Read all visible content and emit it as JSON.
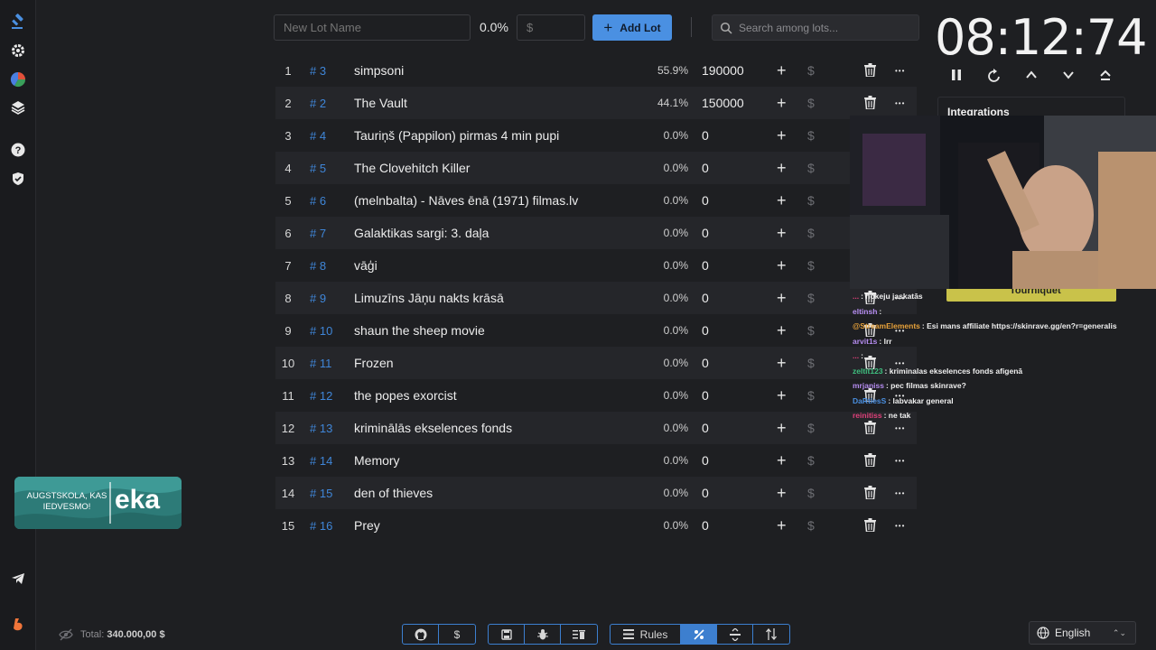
{
  "nav": {
    "items": [
      {
        "icon": "gavel-icon"
      },
      {
        "icon": "gear-icon"
      },
      {
        "icon": "pie-chart-icon"
      },
      {
        "icon": "layers-icon"
      },
      {
        "icon": "help-icon"
      },
      {
        "icon": "shield-icon"
      },
      {
        "icon": "telegram-icon"
      },
      {
        "icon": "boosty-icon"
      }
    ]
  },
  "toolbar": {
    "lot_name_placeholder": "New Lot Name",
    "percent": "0.0%",
    "amount_placeholder": "$",
    "add_lot_label": "Add Lot",
    "search_placeholder": "Search among lots..."
  },
  "lots": [
    {
      "index": "1",
      "id": "# 3",
      "name": "simpsoni",
      "percent": "55.9%",
      "amount": "190000"
    },
    {
      "index": "2",
      "id": "# 2",
      "name": "The Vault",
      "percent": "44.1%",
      "amount": "150000"
    },
    {
      "index": "3",
      "id": "# 4",
      "name": "Tauriņš (Pappilon) pirmas 4 min pupi",
      "percent": "0.0%",
      "amount": "0"
    },
    {
      "index": "4",
      "id": "# 5",
      "name": "The Clovehitch Killer",
      "percent": "0.0%",
      "amount": "0"
    },
    {
      "index": "5",
      "id": "# 6",
      "name": "(melnbalta) - Nāves ēnā (1971) filmas.lv",
      "percent": "0.0%",
      "amount": "0"
    },
    {
      "index": "6",
      "id": "# 7",
      "name": "Galaktikas sargi: 3. daļa",
      "percent": "0.0%",
      "amount": "0"
    },
    {
      "index": "7",
      "id": "# 8",
      "name": "vāģi",
      "percent": "0.0%",
      "amount": "0"
    },
    {
      "index": "8",
      "id": "# 9",
      "name": "Limuzīns Jāņu nakts krāsā",
      "percent": "0.0%",
      "amount": "0"
    },
    {
      "index": "9",
      "id": "# 10",
      "name": "shaun the sheep movie",
      "percent": "0.0%",
      "amount": "0"
    },
    {
      "index": "10",
      "id": "# 11",
      "name": "Frozen",
      "percent": "0.0%",
      "amount": "0"
    },
    {
      "index": "11",
      "id": "# 12",
      "name": "the popes exorcist",
      "percent": "0.0%",
      "amount": "0"
    },
    {
      "index": "12",
      "id": "# 13",
      "name": "kriminālās ekselences fonds",
      "percent": "0.0%",
      "amount": "0"
    },
    {
      "index": "13",
      "id": "# 14",
      "name": "Memory",
      "percent": "0.0%",
      "amount": "0"
    },
    {
      "index": "14",
      "id": "# 15",
      "name": "den of thieves",
      "percent": "0.0%",
      "amount": "0"
    },
    {
      "index": "15",
      "id": "# 16",
      "name": "Prey",
      "percent": "0.0%",
      "amount": "0"
    }
  ],
  "timer": {
    "display": "08:12:74",
    "controls": [
      "pause-icon",
      "reset-icon",
      "chevron-up-icon",
      "chevron-down-icon",
      "eject-icon"
    ]
  },
  "integrations": {
    "title": "Integrations"
  },
  "overlay": {
    "tourniquet_label": "Tourniquet",
    "chat": [
      {
        "user": "...",
        "text": ": hokeju jaskatās",
        "color": "#e0407a"
      },
      {
        "user": "eltinsh",
        "text": ":",
        "color": "#b58cf0"
      },
      {
        "user": "@StreamElements",
        "text": ": Esi mans affiliate https://skinrave.gg/en?r=generalis",
        "color": "#e8a23a"
      },
      {
        "user": "arvit1s",
        "text": ": lrr",
        "color": "#b58cf0"
      },
      {
        "user": "...",
        "text": ":",
        "color": "#e0407a"
      },
      {
        "user": "zeltit123",
        "text": ": kriminalas ekselences fonds afigenā",
        "color": "#3fbf7f"
      },
      {
        "user": "mrjaniss",
        "text": ": pec filmas skinrave?",
        "color": "#b58cf0"
      },
      {
        "user": "DaRtiesS",
        "text": ": labvakar general",
        "color": "#4a8fe0"
      },
      {
        "user": "reinitiss",
        "text": ": ne tak",
        "color": "#e0407a"
      }
    ],
    "eka_badge": {
      "line1": "AUGSTSKOLA, KAS",
      "line2": "IEDVESMO!",
      "brand": "eka"
    }
  },
  "footer": {
    "total_label": "Total:",
    "total_value": "340.000,00 $",
    "group1": [
      "github-icon",
      "dollar-icon"
    ],
    "group2": [
      "save-icon",
      "bug-icon",
      "clear-icon"
    ],
    "group3_rules": "Rules",
    "group3_icons": [
      "percent-icon",
      "split-icon",
      "sort-icon"
    ],
    "language": "English"
  },
  "colors": {
    "accent": "#4a90e2",
    "background": "#1e1f22"
  }
}
